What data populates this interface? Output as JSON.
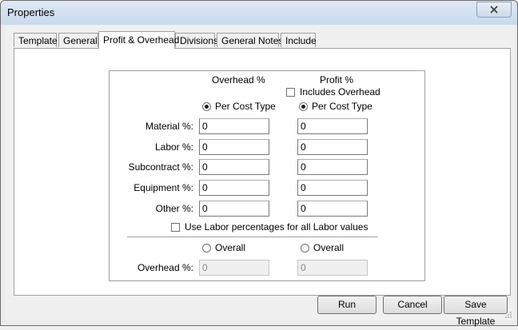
{
  "window": {
    "title": "Properties"
  },
  "tabs": [
    {
      "label": "Template"
    },
    {
      "label": "General"
    },
    {
      "label": "Profit & Overhead"
    },
    {
      "label": "Divisions"
    },
    {
      "label": "General Notes"
    },
    {
      "label": "Include"
    }
  ],
  "active_tab": "Profit & Overhead",
  "overhead": {
    "header": "Overhead %",
    "per_cost_type_label": "Per Cost Type",
    "per_cost_type_selected": true
  },
  "profit": {
    "header": "Profit %",
    "includes_overhead_label": "Includes Overhead",
    "includes_overhead_checked": false,
    "per_cost_type_label": "Per Cost Type",
    "per_cost_type_selected": true
  },
  "rows": [
    {
      "label": "Material %:",
      "overhead": "0",
      "profit": "0"
    },
    {
      "label": "Labor %:",
      "overhead": "0",
      "profit": "0"
    },
    {
      "label": "Subcontract %:",
      "overhead": "0",
      "profit": "0"
    },
    {
      "label": "Equipment %:",
      "overhead": "0",
      "profit": "0"
    },
    {
      "label": "Other %:",
      "overhead": "0",
      "profit": "0"
    }
  ],
  "use_labor_percentages": {
    "label": "Use Labor percentages for all Labor values",
    "checked": false
  },
  "overall": {
    "overhead_radio_label": "Overall",
    "profit_radio_label": "Overall",
    "row_label": "Overhead %:",
    "overhead_value": "0",
    "profit_value": "0"
  },
  "buttons": {
    "run": "Run",
    "cancel": "Cancel",
    "save_template": "Save Template"
  }
}
